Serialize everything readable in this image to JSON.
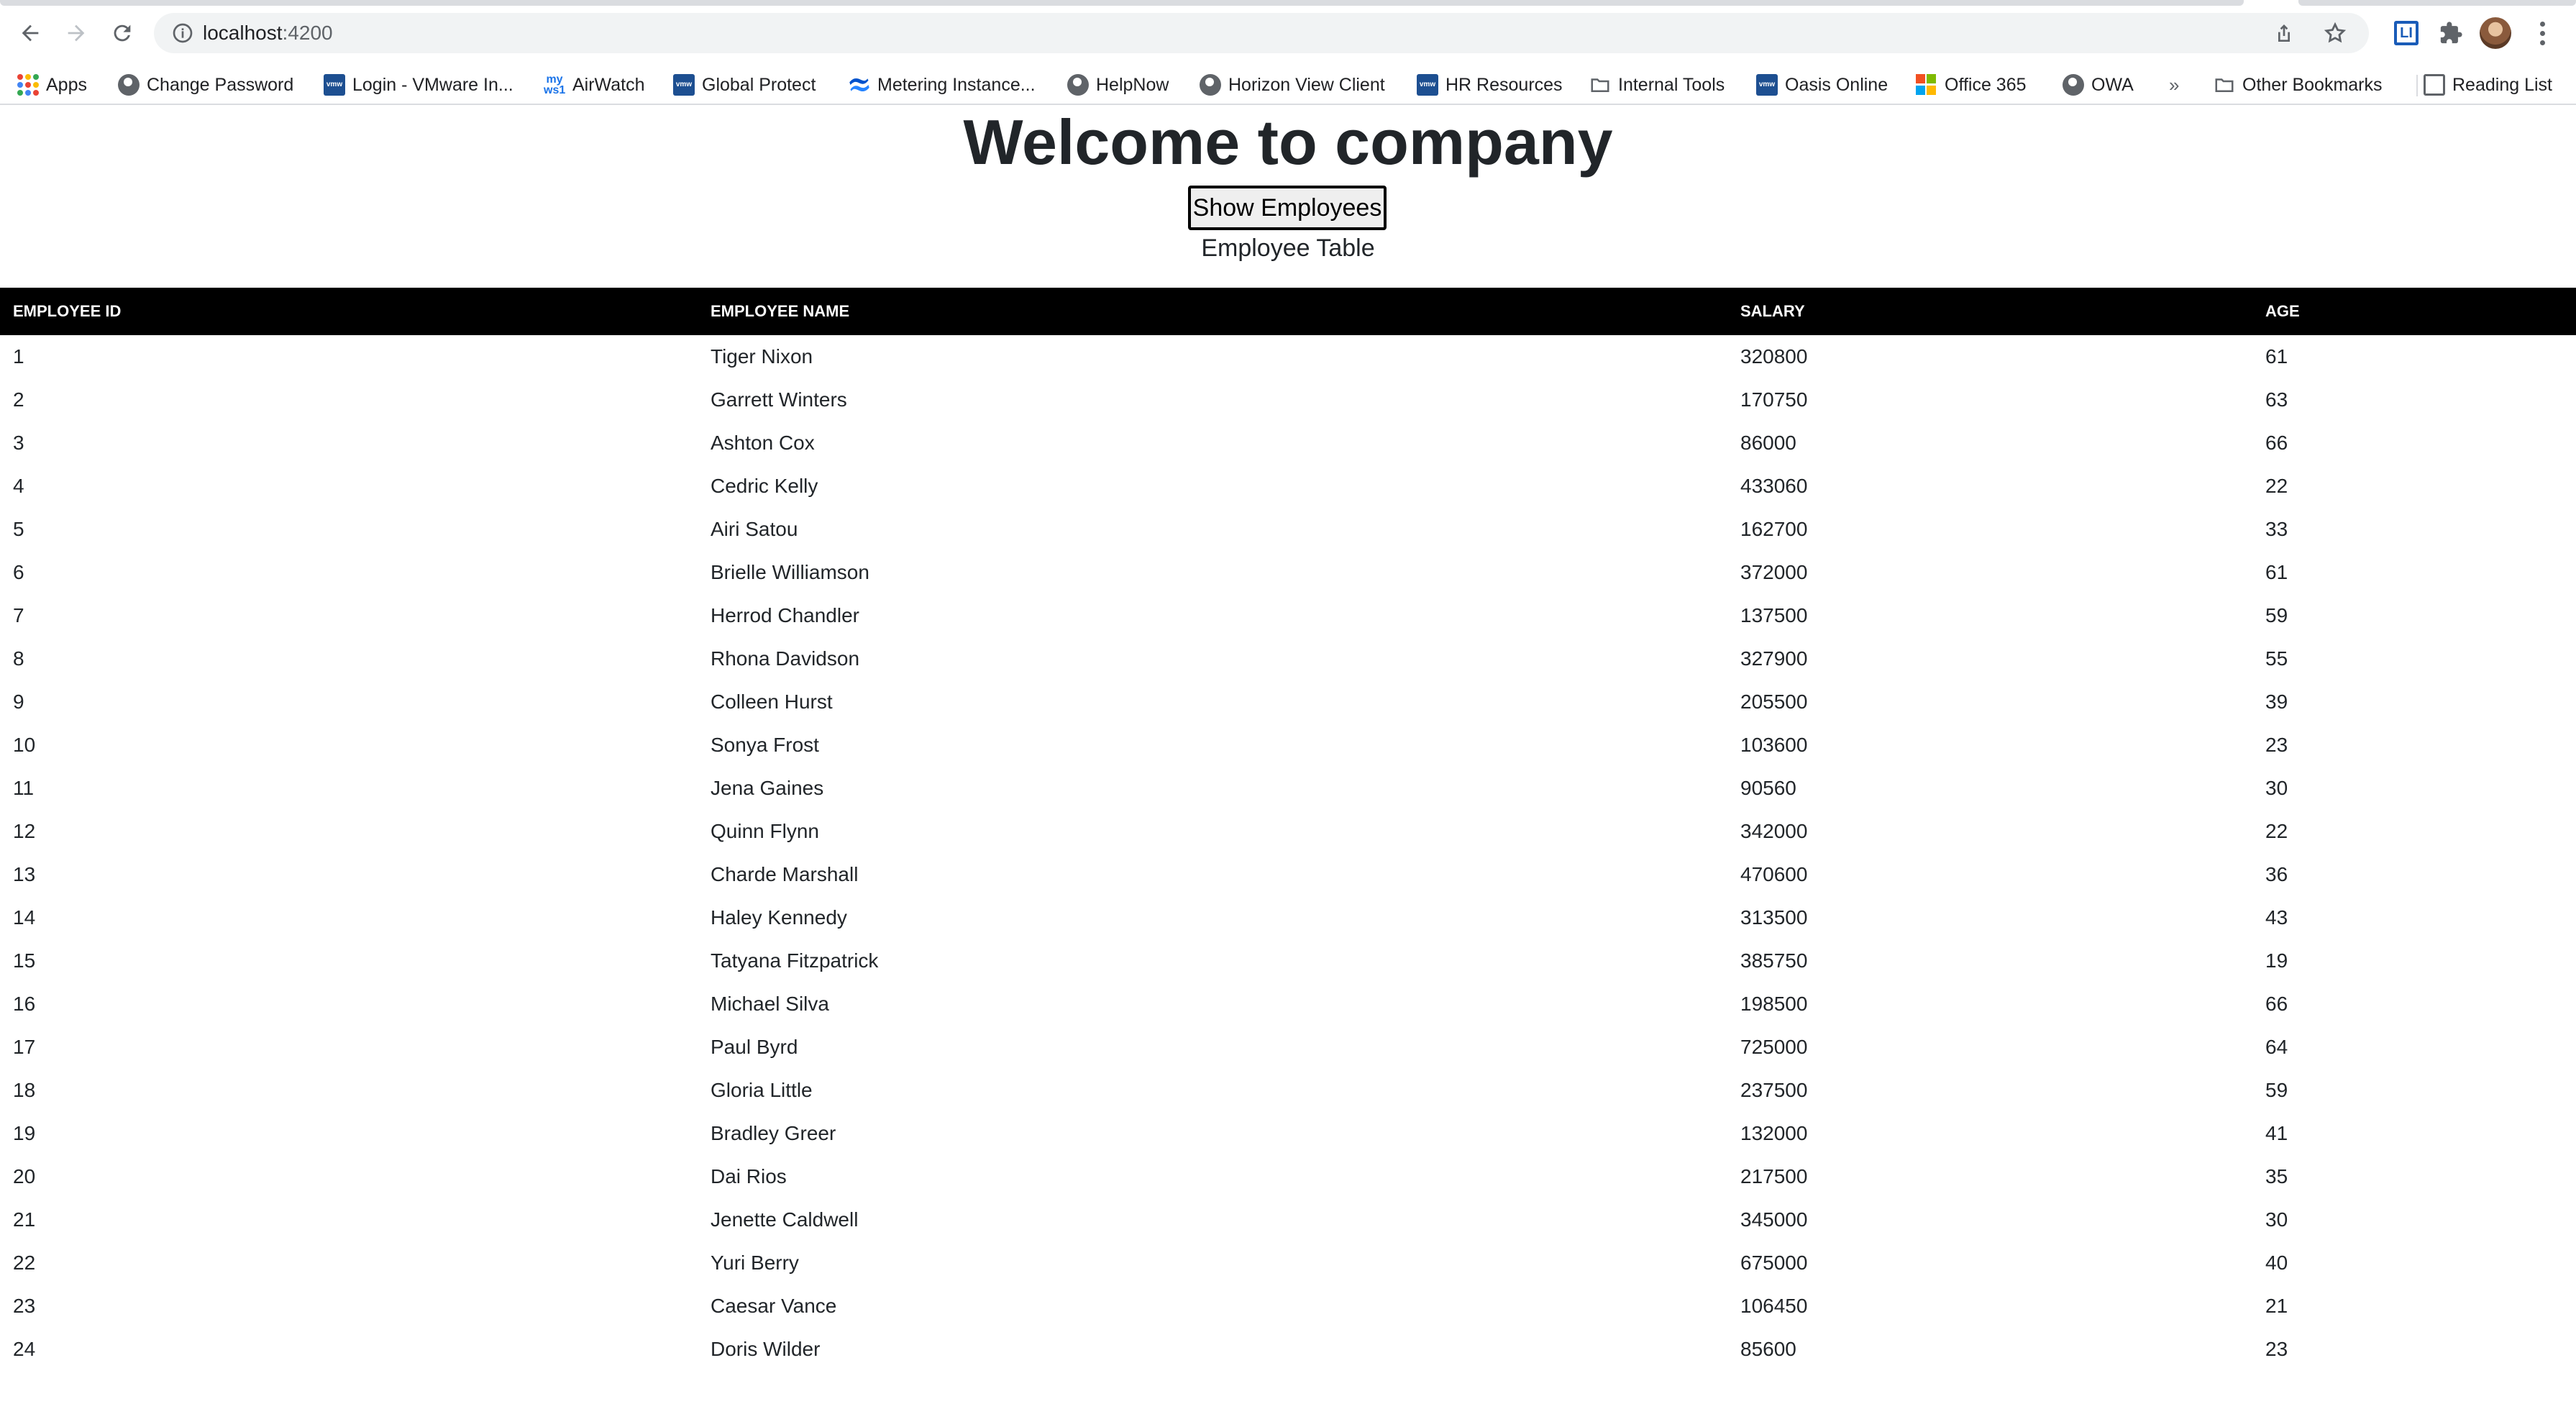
{
  "browser": {
    "url_host": "localhost",
    "url_port": ":4200",
    "bookmarks": [
      {
        "label": "Apps",
        "icon": "apps-grid-icon"
      },
      {
        "label": "Change Password",
        "icon": "globe-icon"
      },
      {
        "label": "Login - VMware In...",
        "icon": "vmware-icon"
      },
      {
        "label": "AirWatch",
        "icon": "workspace-one-icon"
      },
      {
        "label": "Global Protect",
        "icon": "vmware-icon"
      },
      {
        "label": "Metering Instance...",
        "icon": "confluence-icon"
      },
      {
        "label": "HelpNow",
        "icon": "globe-icon"
      },
      {
        "label": "Horizon View Client",
        "icon": "globe-icon"
      },
      {
        "label": "HR Resources",
        "icon": "vmware-icon"
      },
      {
        "label": "Internal Tools",
        "icon": "folder-icon"
      },
      {
        "label": "Oasis Online",
        "icon": "vmware-icon"
      },
      {
        "label": "Office 365",
        "icon": "microsoft-icon"
      },
      {
        "label": "OWA",
        "icon": "globe-icon"
      }
    ],
    "overflow_label": "»",
    "other_bookmarks": "Other Bookmarks",
    "reading_list": "Reading List"
  },
  "page": {
    "title": "Welcome to company",
    "show_button": "Show Employees",
    "table_caption": "Employee Table"
  },
  "table": {
    "headers": [
      "EMPLOYEE ID",
      "EMPLOYEE NAME",
      "SALARY",
      "AGE"
    ],
    "rows": [
      [
        "1",
        "Tiger Nixon",
        "320800",
        "61"
      ],
      [
        "2",
        "Garrett Winters",
        "170750",
        "63"
      ],
      [
        "3",
        "Ashton Cox",
        "86000",
        "66"
      ],
      [
        "4",
        "Cedric Kelly",
        "433060",
        "22"
      ],
      [
        "5",
        "Airi Satou",
        "162700",
        "33"
      ],
      [
        "6",
        "Brielle Williamson",
        "372000",
        "61"
      ],
      [
        "7",
        "Herrod Chandler",
        "137500",
        "59"
      ],
      [
        "8",
        "Rhona Davidson",
        "327900",
        "55"
      ],
      [
        "9",
        "Colleen Hurst",
        "205500",
        "39"
      ],
      [
        "10",
        "Sonya Frost",
        "103600",
        "23"
      ],
      [
        "11",
        "Jena Gaines",
        "90560",
        "30"
      ],
      [
        "12",
        "Quinn Flynn",
        "342000",
        "22"
      ],
      [
        "13",
        "Charde Marshall",
        "470600",
        "36"
      ],
      [
        "14",
        "Haley Kennedy",
        "313500",
        "43"
      ],
      [
        "15",
        "Tatyana Fitzpatrick",
        "385750",
        "19"
      ],
      [
        "16",
        "Michael Silva",
        "198500",
        "66"
      ],
      [
        "17",
        "Paul Byrd",
        "725000",
        "64"
      ],
      [
        "18",
        "Gloria Little",
        "237500",
        "59"
      ],
      [
        "19",
        "Bradley Greer",
        "132000",
        "41"
      ],
      [
        "20",
        "Dai Rios",
        "217500",
        "35"
      ],
      [
        "21",
        "Jenette Caldwell",
        "345000",
        "30"
      ],
      [
        "22",
        "Yuri Berry",
        "675000",
        "40"
      ],
      [
        "23",
        "Caesar Vance",
        "106450",
        "21"
      ],
      [
        "24",
        "Doris Wilder",
        "85600",
        "23"
      ]
    ]
  },
  "colors": {
    "header_bg": "#000000",
    "header_text": "#ffffff",
    "omnibox_bg": "#f1f3f4"
  }
}
